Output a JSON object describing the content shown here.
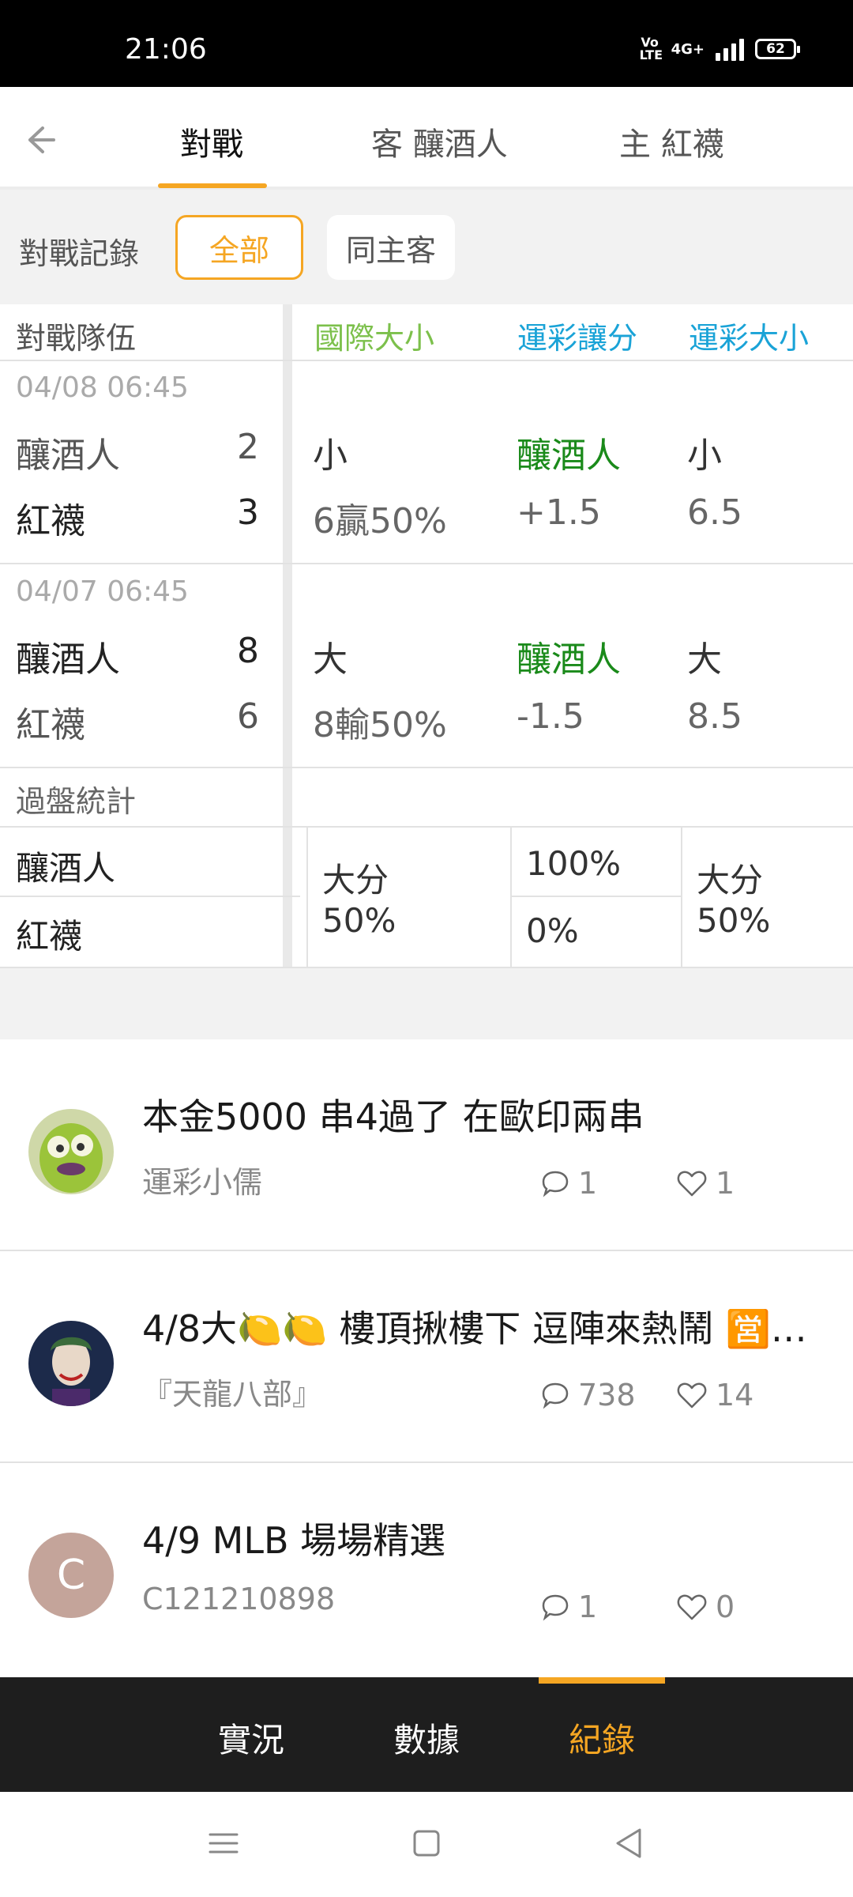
{
  "status_bar": {
    "time": "21:06",
    "volte": "Vo LTE",
    "network": "4G+",
    "battery": "62"
  },
  "top_tabs": {
    "items": [
      {
        "label": "對戰",
        "active": true
      },
      {
        "label": "客 釀酒人",
        "active": false
      },
      {
        "label": "主 紅襪",
        "active": false
      }
    ],
    "accent_color": "#f5a623"
  },
  "filter": {
    "label": "對戰記錄",
    "chips": [
      {
        "label": "全部",
        "selected": true
      },
      {
        "label": "同主客",
        "selected": false
      }
    ]
  },
  "table": {
    "headers": {
      "team": "對戰隊伍",
      "intl_total": "國際大小",
      "spread": "運彩讓分",
      "total": "運彩大小"
    },
    "matches": [
      {
        "date": "04/08 06:45",
        "away": {
          "team": "釀酒人",
          "score": "2"
        },
        "home": {
          "team": "紅襪",
          "score": "3"
        },
        "intl_result": "小",
        "intl_detail": "6贏50%",
        "spread_team": "釀酒人",
        "spread_line": "+1.5",
        "total_result": "小",
        "total_line": "6.5"
      },
      {
        "date": "04/07 06:45",
        "away": {
          "team": "釀酒人",
          "score": "8"
        },
        "home": {
          "team": "紅襪",
          "score": "6"
        },
        "intl_result": "大",
        "intl_detail": "8輸50%",
        "spread_team": "釀酒人",
        "spread_line": "-1.5",
        "total_result": "大",
        "total_line": "8.5"
      }
    ],
    "stats": {
      "label": "過盤統計",
      "teams": [
        "釀酒人",
        "紅襪"
      ],
      "intl_label": "大分",
      "intl_pct": "50%",
      "spread_away_pct": "100%",
      "spread_home_pct": "0%",
      "total_label": "大分",
      "total_pct": "50%"
    }
  },
  "posts": [
    {
      "title": "本金5000 串4過了 在歐印兩串",
      "author": "運彩小儒",
      "comments": "1",
      "likes": "1",
      "avatar": "cartoon-avatar"
    },
    {
      "title": "4/8大🍋🍋 樓頂揪樓下 逗陣來熱鬧 🈺…",
      "author": "『天龍八部』",
      "comments": "738",
      "likes": "14",
      "avatar": "joker-avatar"
    },
    {
      "title": "4/9 MLB 場場精選",
      "author": "C121210898",
      "comments": "1",
      "likes": "0",
      "avatar": "letter-avatar",
      "initial": "C"
    }
  ],
  "bottom_nav": {
    "items": [
      {
        "label": "實況",
        "active": false
      },
      {
        "label": "數據",
        "active": false
      },
      {
        "label": "紀錄",
        "active": true
      }
    ]
  }
}
